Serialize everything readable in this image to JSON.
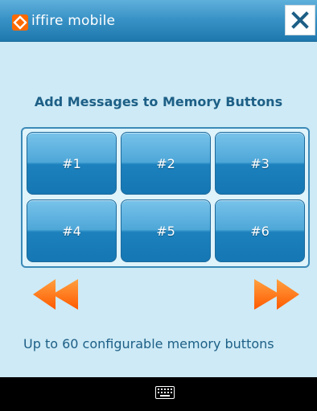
{
  "app": {
    "title": "iffire mobile"
  },
  "header": {
    "heading": "Add Messages to Memory Buttons"
  },
  "memory_buttons": [
    {
      "label": "#1"
    },
    {
      "label": "#2"
    },
    {
      "label": "#3"
    },
    {
      "label": "#4"
    },
    {
      "label": "#5"
    },
    {
      "label": "#6"
    }
  ],
  "navigation": {
    "prev_icon": "rewind-double-arrow-icon",
    "next_icon": "fast-forward-double-arrow-icon"
  },
  "footnote": "Up to 60 configurable memory buttons",
  "system": {
    "keyboard_icon": "keyboard-icon",
    "close_icon": "close-x-icon"
  },
  "colors": {
    "background": "#cdeaf6",
    "accent": "#1d5f86",
    "button_blue": "#1c81bd",
    "arrow_orange": "#ff6a00"
  }
}
